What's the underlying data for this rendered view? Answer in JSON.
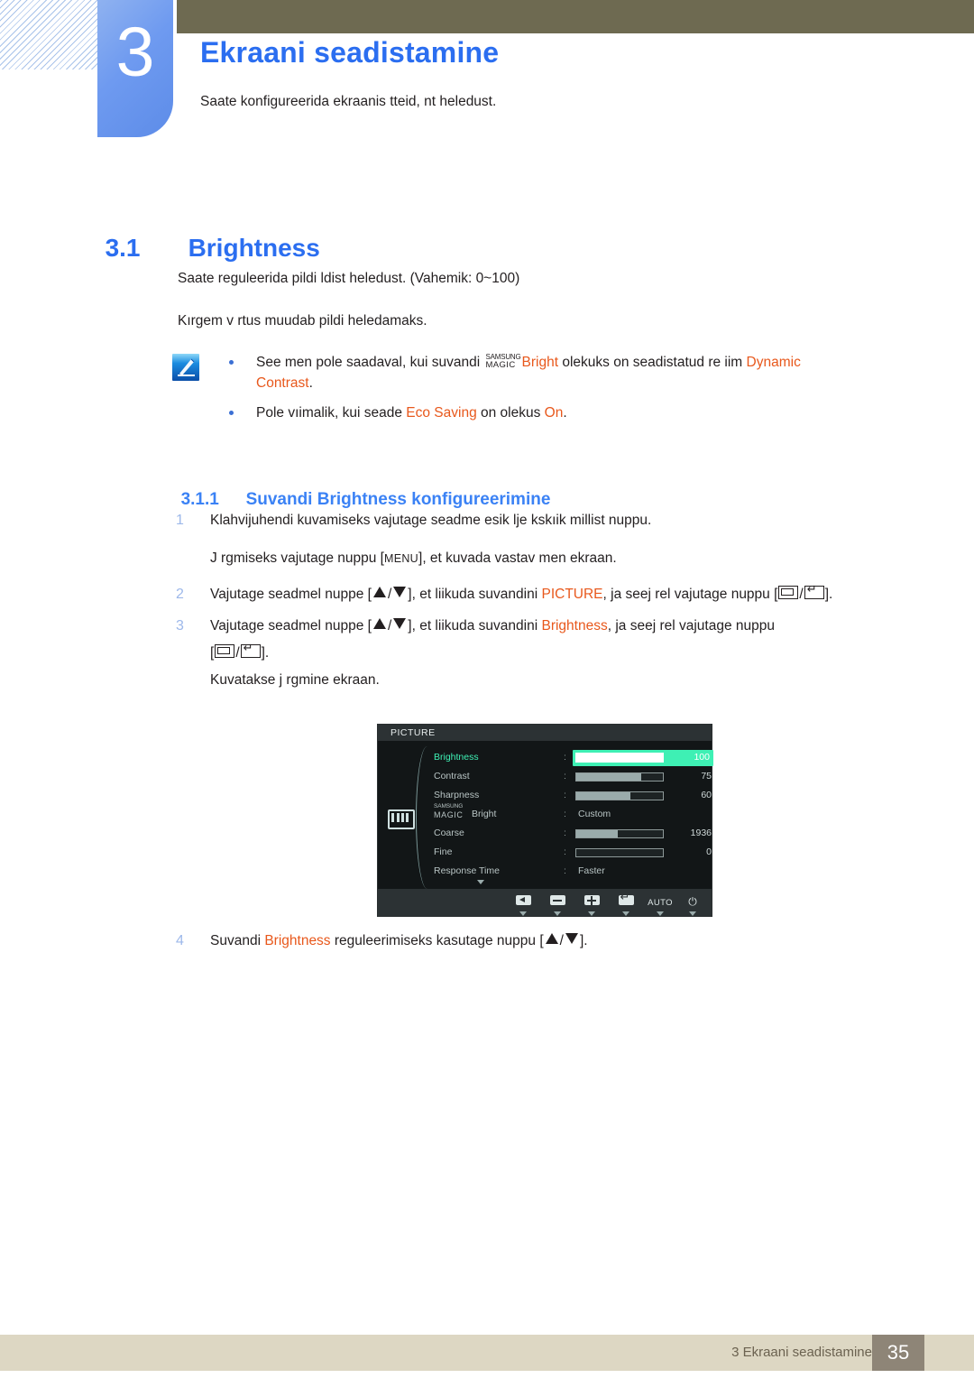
{
  "header": {
    "chapter_number": "3",
    "chapter_title": "Ekraani seadistamine",
    "chapter_subtitle": "Saate konfigureerida ekraanis tteid, nt heledust."
  },
  "section": {
    "number": "3.1",
    "title": "Brightness",
    "intro1": "Saate reguleerida pildi ldist heledust. (Vahemik: 0~100)",
    "intro2": "Kırgem v rtus muudab pildi heledamaks."
  },
  "note": {
    "icon": "note-pencil-icon",
    "items": [
      {
        "t1": "See men  pole saadaval, kui suvandi ",
        "magic_top": "SAMSUNG",
        "magic_bot": "MAGIC",
        "t2": "Bright",
        "t3": " olekuks on seadistatud re iim ",
        "t4": "Dynamic Contrast",
        "t5": "."
      },
      {
        "t1": "Pole vıimalik, kui seade ",
        "t2": "Eco Saving",
        "t3": " on olekus ",
        "t4": "On",
        "t5": "."
      }
    ]
  },
  "subsection": {
    "number": "3.1.1",
    "title": "Suvandi Brightness konfigureerimine"
  },
  "steps": {
    "s1_num": "1",
    "s1_text": "Klahvijuhendi kuvamiseks vajutage seadme esik lje  kskıik millist nuppu.",
    "s1_cont_a": "J rgmiseks vajutage nuppu [",
    "s1_cont_key": "MENU",
    "s1_cont_b": "], et kuvada vastav men  ekraan.",
    "s2_num": "2",
    "s2_a": "Vajutage seadmel nuppe [",
    "s2_b": "], et liikuda suvandini ",
    "s2_highlight": "PICTURE",
    "s2_c": ", ja seej rel vajutage nuppu [",
    "s2_d": "].",
    "s3_num": "3",
    "s3_a": "Vajutage seadmel nuppe [",
    "s3_b": "], et liikuda suvandini ",
    "s3_highlight": "Brightness",
    "s3_c": ", ja seej rel vajutage nuppu",
    "s3_cont_open": "[",
    "s3_cont_close": "].",
    "s3_result": "Kuvatakse j rgmine ekraan.",
    "s4_num": "4",
    "s4_a": "Suvandi ",
    "s4_highlight": "Brightness",
    "s4_b": " reguleerimiseks kasutage nuppu [",
    "s4_c": "]."
  },
  "osd": {
    "title": "PICTURE",
    "side_icon": "picture-bars-icon",
    "rows": [
      {
        "label": "Brightness",
        "type": "bar",
        "value": "100",
        "fill_pct": 100,
        "active": true
      },
      {
        "label": "Contrast",
        "type": "bar",
        "value": "75",
        "fill_pct": 75,
        "active": false
      },
      {
        "label": "Sharpness",
        "type": "bar",
        "value": "60",
        "fill_pct": 62,
        "active": false
      },
      {
        "label": "MAGIC Bright",
        "magic_top": "SAMSUNG",
        "magic_bot": "MAGIC",
        "magic_word": "Bright",
        "type": "text",
        "value": "Custom",
        "active": false
      },
      {
        "label": "Coarse",
        "type": "bar",
        "value": "1936",
        "fill_pct": 48,
        "active": false
      },
      {
        "label": "Fine",
        "type": "bar",
        "value": "0",
        "fill_pct": 0,
        "active": false
      },
      {
        "label": "Response Time",
        "type": "text",
        "value": "Faster",
        "active": false
      }
    ],
    "buttons": [
      {
        "name": "back",
        "glyph": "left"
      },
      {
        "name": "minus",
        "glyph": "minus"
      },
      {
        "name": "plus",
        "glyph": "plus"
      },
      {
        "name": "enter",
        "glyph": "enter"
      },
      {
        "name": "auto",
        "glyph": "auto",
        "label": "AUTO"
      },
      {
        "name": "power",
        "glyph": "power",
        "label": "⏻"
      }
    ]
  },
  "footer": {
    "text": "3 Ekraani seadistamine",
    "page": "35"
  },
  "colors": {
    "heading_blue": "#2b6ef0",
    "subheading_blue": "#3b82f5",
    "highlight_orange": "#e8581c",
    "olive": "#6e6a51",
    "footer_beige": "#ddd7c3",
    "footer_page_box": "#8e8577",
    "osd_active_green": "#3ef0b4"
  }
}
